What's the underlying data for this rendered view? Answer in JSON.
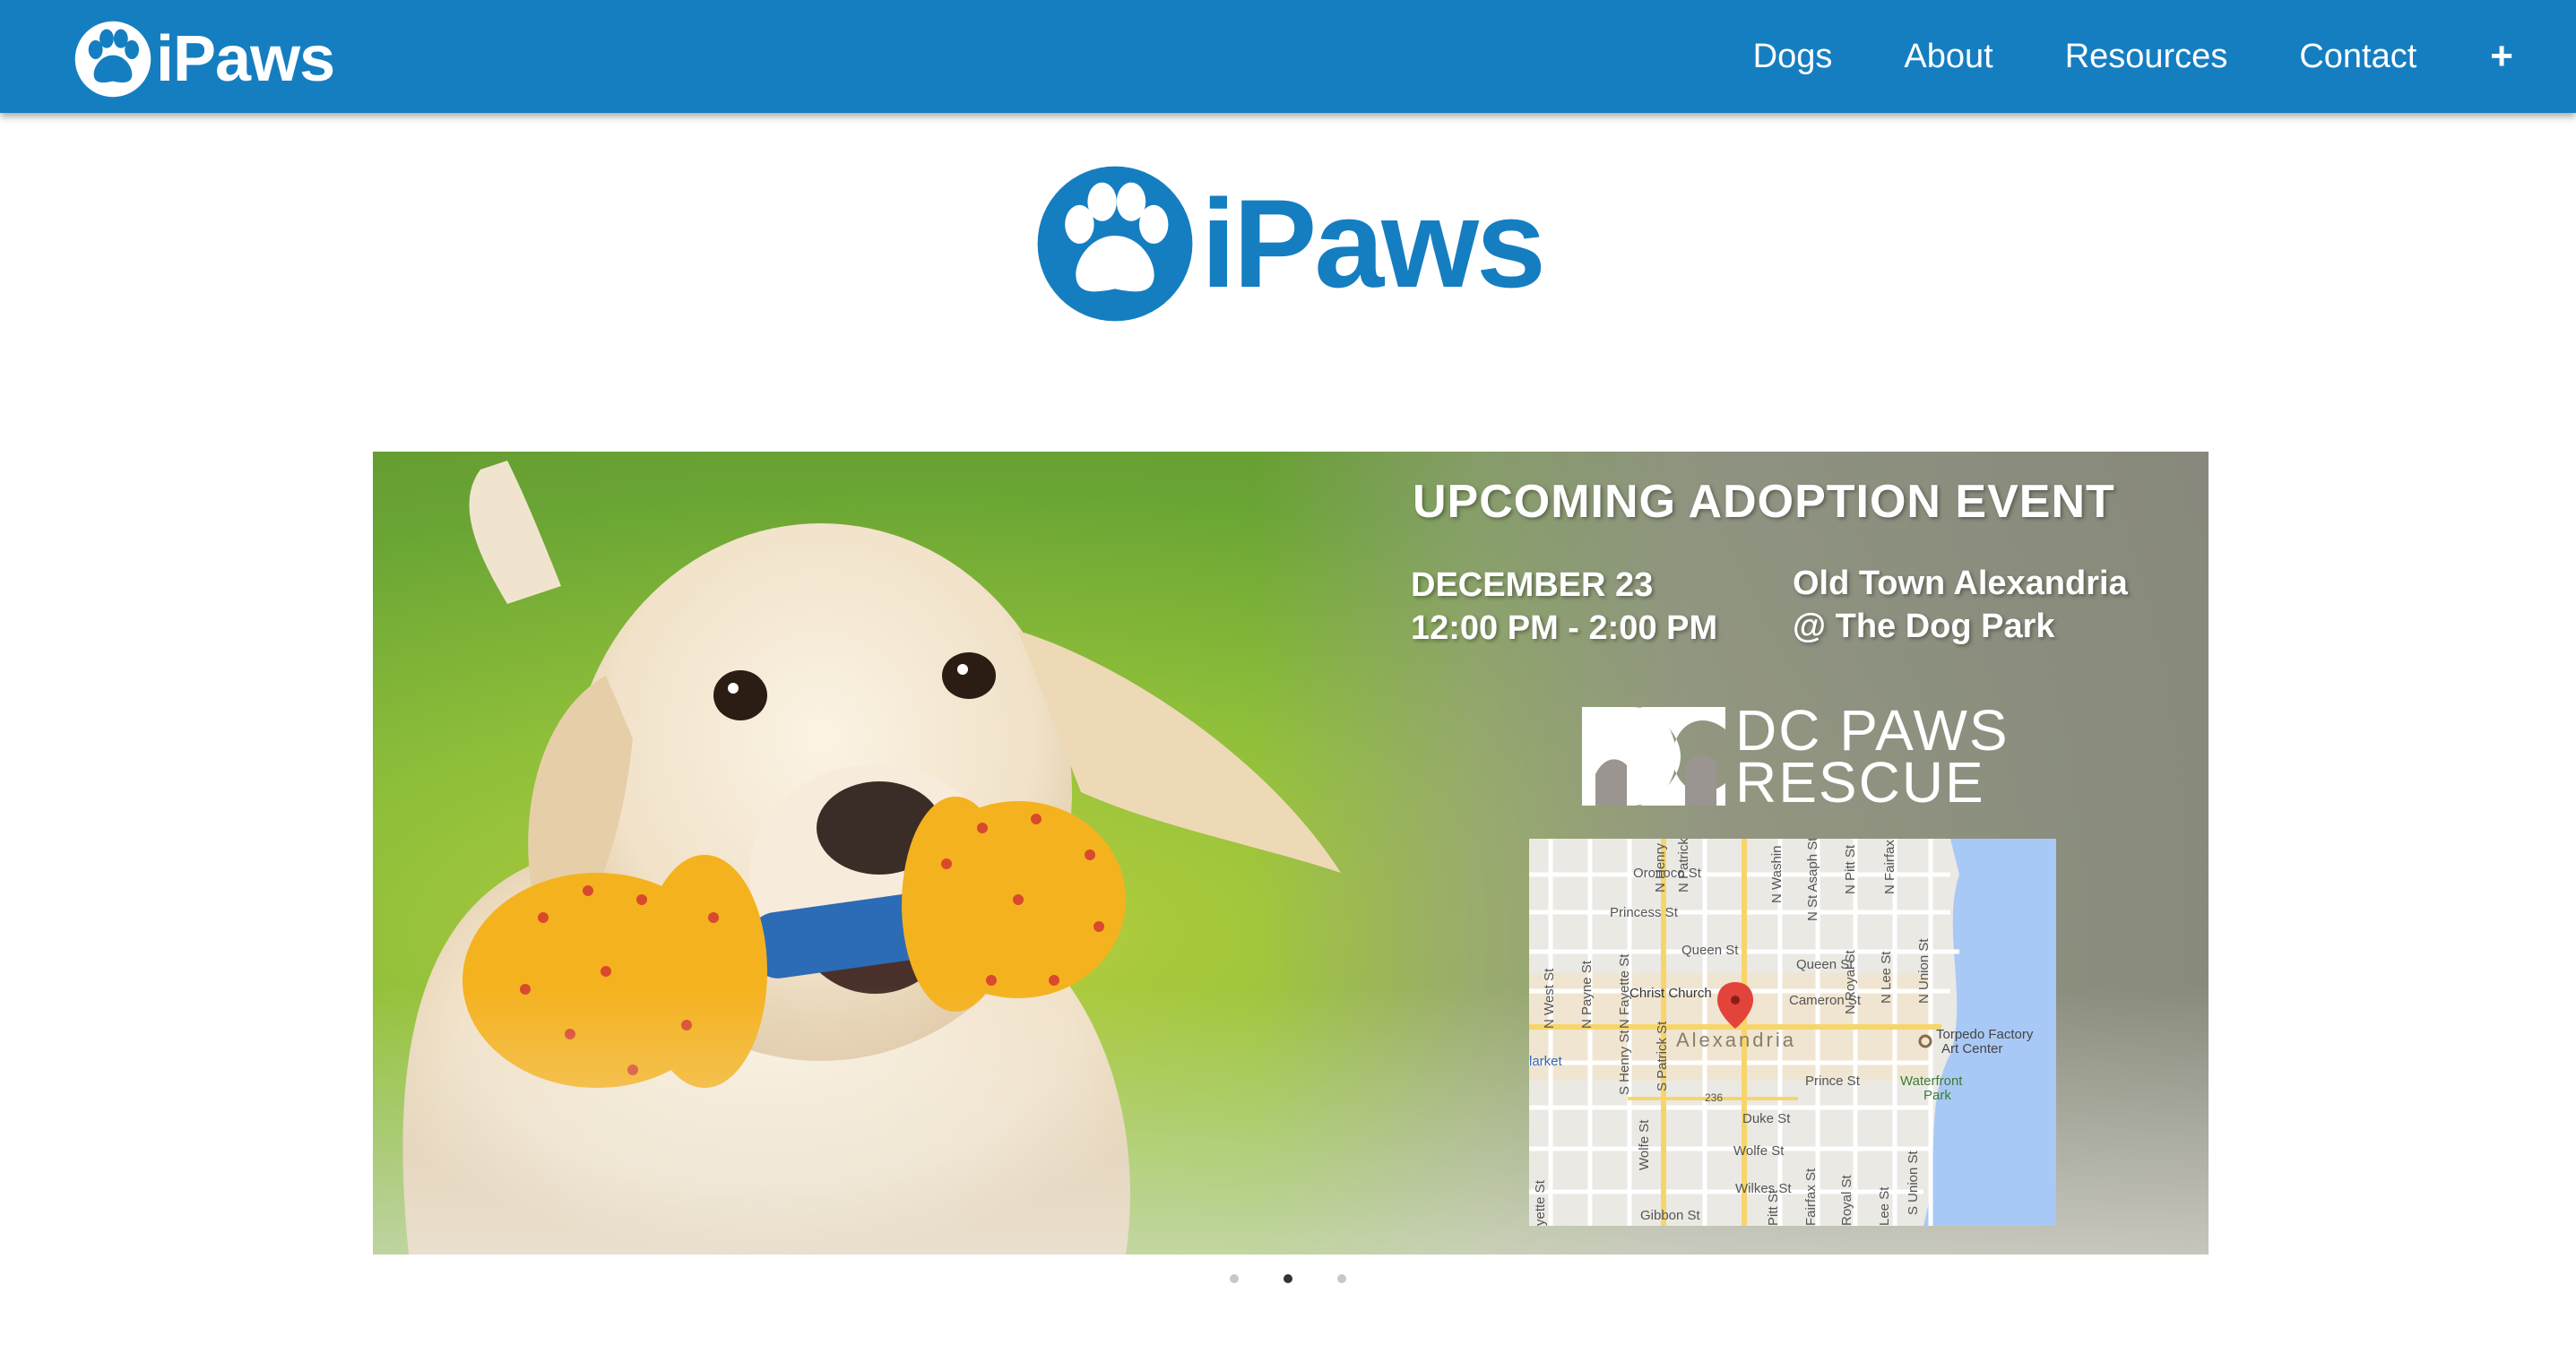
{
  "navbar": {
    "brand": "iPaws",
    "links": [
      "Dogs",
      "About",
      "Resources",
      "Contact"
    ],
    "plus": "+"
  },
  "hero": {
    "logo_text": "iPaws"
  },
  "slide": {
    "title": "UPCOMING ADOPTION EVENT",
    "date": "DECEMBER 23",
    "time": "12:00 PM - 2:00 PM",
    "place": "Old Town Alexandria",
    "venue": "@ The Dog Park",
    "rescue_line1": "DC PAWS",
    "rescue_line2": "RESCUE",
    "map_labels": {
      "oronoco": "Oronoco St",
      "princess": "Princess St",
      "queen1": "Queen St",
      "queen2": "Queen St",
      "christ_church": "Christ Church",
      "cameron": "Cameron St",
      "alexandria": "Alexandria",
      "torpedo1": "Torpedo Factory",
      "torpedo2": "Art Center",
      "market": "larket",
      "prince": "Prince St",
      "waterfront1": "Waterfront",
      "waterfront2": "Park",
      "duke": "Duke St",
      "wolfe": "Wolfe St",
      "wilkes": "Wilkes St",
      "gibbon": "Gibbon St",
      "route": "236",
      "n_henry": "N Henry St",
      "n_patrick": "N Patrick",
      "n_west": "N West St",
      "n_payne": "N Payne St",
      "n_fayette": "N Fayette St",
      "n_washington": "N Washin",
      "n_st_asaph": "N St Asaph St",
      "n_pitt": "N Pitt St",
      "n_royal": "N Royal St",
      "n_fairfax": "N Fairfax",
      "n_lee": "N Lee St",
      "n_union": "N Union St",
      "s_henry": "S Henry St",
      "s_patrick": "S Patrick St",
      "wolfe_st": "Wolfe St",
      "fayette": "yette St",
      "s_fairfax": "Fairfax St",
      "s_royal": "Royal St",
      "s_lee": "Lee St",
      "s_union": "S Union St",
      "s_pitt": "Pitt St"
    }
  },
  "carousel": {
    "slide_count": 3,
    "active_index": 1
  },
  "colors": {
    "brand_blue": "#157ec1",
    "white": "#ffffff"
  },
  "icons": {
    "brand": "paw-icon",
    "hero": "paw-icon",
    "map_pin": "map-pin-icon"
  }
}
